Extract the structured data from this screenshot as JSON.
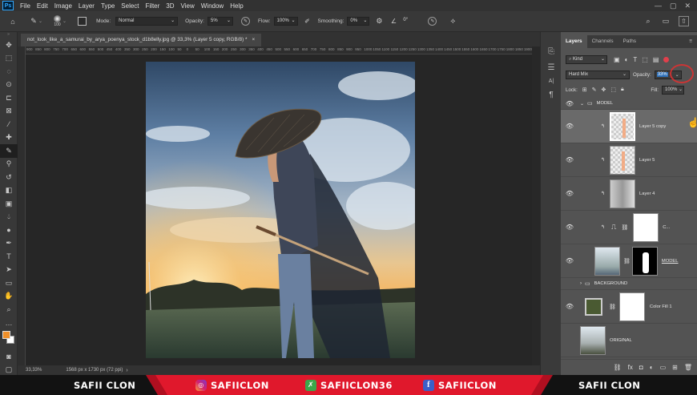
{
  "menubar": {
    "app_icon": "Ps",
    "items": [
      "File",
      "Edit",
      "Image",
      "Layer",
      "Type",
      "Select",
      "Filter",
      "3D",
      "View",
      "Window",
      "Help"
    ]
  },
  "options": {
    "brush_size": "100",
    "mode_label": "Mode:",
    "mode_value": "Normal",
    "opacity_label": "Opacity:",
    "opacity_value": "5%",
    "flow_label": "Flow:",
    "flow_value": "100%",
    "smoothing_label": "Smoothing:",
    "smoothing_value": "0%",
    "angle_value": "0°"
  },
  "document": {
    "tab_title": "not_look_like_a_samurai_by_arya_poenya_stock_d1b8elly.jpg @ 33,3% (Layer 5 copy, RGB/8) *",
    "close": "×",
    "ruler_marks": [
      "900",
      "850",
      "800",
      "750",
      "700",
      "650",
      "600",
      "550",
      "500",
      "450",
      "400",
      "350",
      "300",
      "250",
      "200",
      "150",
      "100",
      "50",
      "0",
      "50",
      "100",
      "150",
      "200",
      "250",
      "300",
      "350",
      "400",
      "450",
      "500",
      "550",
      "600",
      "650",
      "700",
      "750",
      "800",
      "850",
      "900",
      "950",
      "1000",
      "1050",
      "1100",
      "1150",
      "1200",
      "1250",
      "1300",
      "1350",
      "1400",
      "1450",
      "1500",
      "1550",
      "1600",
      "1650",
      "1700",
      "1750",
      "1800",
      "1850",
      "1900"
    ],
    "zoom": "33,33%",
    "doc_info": "1568 px x 1730 px (72 ppi)"
  },
  "layers_panel": {
    "tabs": [
      "Layers",
      "Channels",
      "Paths"
    ],
    "filter_kind": "Kind",
    "blend_mode": "Hard Mix",
    "opacity_label": "Opacity:",
    "opacity_value": "33%",
    "lock_label": "Lock:",
    "fill_label": "Fill:",
    "fill_value": "100%",
    "layers": [
      {
        "name": "MODEL",
        "type": "group"
      },
      {
        "name": "Layer 5 copy",
        "type": "pixel",
        "selected": true
      },
      {
        "name": "Layer 5",
        "type": "pixel"
      },
      {
        "name": "Layer 4",
        "type": "pixel"
      },
      {
        "name": "C...",
        "type": "adjustment"
      },
      {
        "name": "MODEL",
        "type": "masked"
      },
      {
        "name": "BACKGROUND",
        "type": "group"
      },
      {
        "name": "Color Fill 1",
        "type": "fill"
      },
      {
        "name": "ORIGINAL",
        "type": "pixel"
      }
    ]
  },
  "banner": {
    "left_name": "SAFII CLON",
    "instagram": "SAFIICLON",
    "other_handle": "SAFIICLON36",
    "facebook": "SAFIICLON",
    "right_name": "SAFII CLON"
  },
  "colors": {
    "foreground": "#f0902a",
    "background": "#ffffff",
    "accent_red": "#e0182c",
    "selection_blue": "#2d6fb7",
    "fill_swatch": "#4a5a32"
  }
}
